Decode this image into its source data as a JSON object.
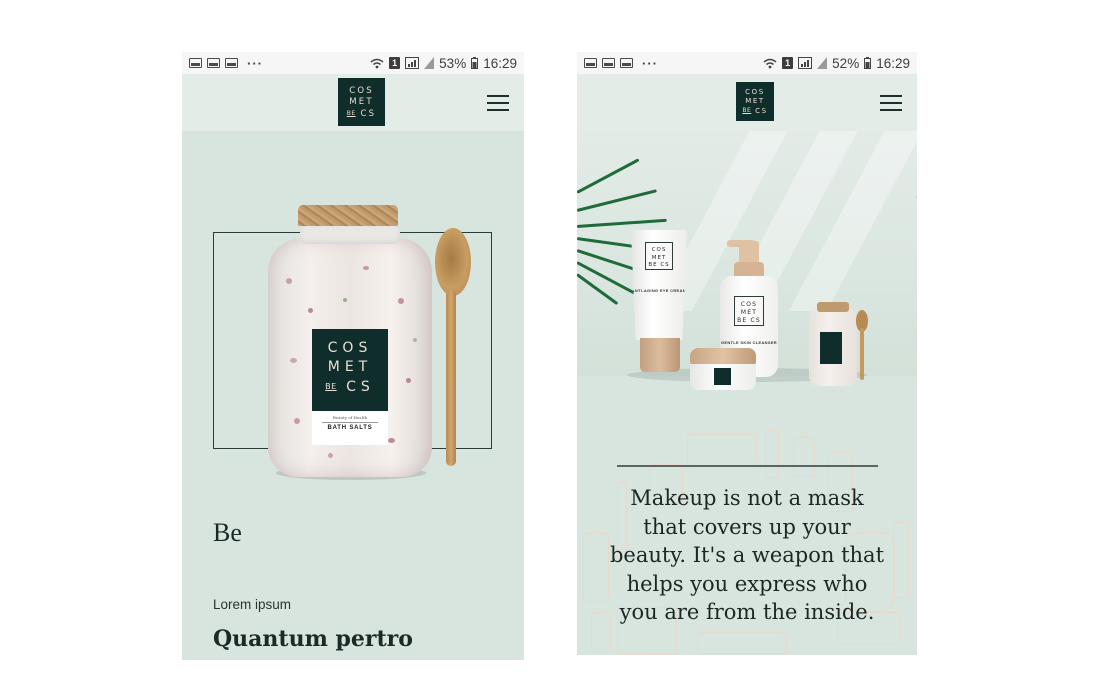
{
  "left_phone": {
    "status": {
      "battery": "53%",
      "time": "16:29",
      "dots": "···",
      "sim": "1"
    },
    "logo": {
      "line1": "COS",
      "line2": "MET",
      "line3_small": "BE",
      "line3": "CS"
    },
    "product_label": {
      "line1": "COS",
      "line2": "MET",
      "line3_small": "BE",
      "line3": "CS",
      "subtitle": "Beauty of Health",
      "name": "BATH SALTS"
    },
    "heading": "Be",
    "eyebrow": "Lorem ipsum",
    "title": "Quantum pertro"
  },
  "right_phone": {
    "status": {
      "battery": "52%",
      "time": "16:29",
      "dots": "···",
      "sim": "1"
    },
    "logo": {
      "line1": "COS",
      "line2": "MET",
      "line3_small": "BE",
      "line3": "CS"
    },
    "products": {
      "tube_text": "ANTI-AGING EYE CREAM",
      "bottle_text": "GENTLE SKIN CLEANSER"
    },
    "quote": "Makeup is not a mask that covers up your beauty. It's a weapon that helps you express who you are from the inside."
  },
  "icons": [
    "image-icon",
    "gallery-icon",
    "wifi-icon",
    "signal-icon",
    "battery-icon",
    "hamburger-menu-icon"
  ],
  "colors": {
    "brand_dark": "#0f2d2a",
    "background_mint": "#d8e5de",
    "header_mint": "#e3ece7",
    "logo_text": "#e9dccf"
  }
}
